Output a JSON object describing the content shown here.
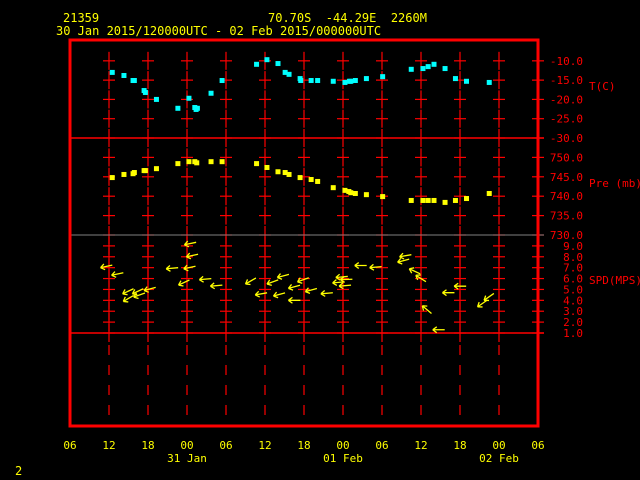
{
  "header": {
    "station": "21359",
    "location": "70.70S  -44.29E  2260M",
    "period": "30 Jan 2015/120000UTC - 02 Feb 2015/000000UTC"
  },
  "footer_label": "2",
  "colors": {
    "frame": "#ff0000",
    "text": "#ffff00",
    "temperature": "#00ffff",
    "pressure": "#ffff00",
    "wind": "#ffff00",
    "separator": "#808080"
  },
  "chart_data": {
    "type": "scatter",
    "title": "21359  70.70S -44.29E 2260M",
    "time_axis": {
      "unit": "hours since 30 Jan 2015 12Z",
      "range": [
        -6,
        66
      ],
      "tick_labels": [
        "06",
        "12",
        "18",
        "00",
        "06",
        "12",
        "18",
        "00",
        "06",
        "12",
        "18",
        "00",
        "06"
      ],
      "date_labels": [
        {
          "label": "31 Jan",
          "hour": 12
        },
        {
          "label": "01 Feb",
          "hour": 36
        },
        {
          "label": "02 Feb",
          "hour": 60
        }
      ]
    },
    "panels": [
      {
        "name": "temperature",
        "label": "T(C)",
        "ylim": [
          -30,
          -4.6
        ],
        "ticks": [
          "-10.0",
          "-15.0",
          "-20.0",
          "-25.0",
          "-30.0"
        ],
        "tick_values": [
          -10,
          -15,
          -20,
          -25,
          -30
        ],
        "points": [
          [
            0.5,
            -13.0
          ],
          [
            2.3,
            -13.8
          ],
          [
            3.7,
            -15.1
          ],
          [
            3.9,
            -15.1
          ],
          [
            5.4,
            -17.7
          ],
          [
            5.6,
            -18.2
          ],
          [
            7.3,
            -20.0
          ],
          [
            10.6,
            -22.3
          ],
          [
            12.3,
            -19.7
          ],
          [
            13.2,
            -22.1
          ],
          [
            13.4,
            -22.6
          ],
          [
            13.6,
            -22.3
          ],
          [
            15.7,
            -18.4
          ],
          [
            17.4,
            -15.1
          ],
          [
            22.7,
            -10.9
          ],
          [
            24.3,
            -9.7
          ],
          [
            26.0,
            -10.7
          ],
          [
            27.1,
            -13.0
          ],
          [
            27.7,
            -13.5
          ],
          [
            29.4,
            -14.6
          ],
          [
            29.5,
            -15.1
          ],
          [
            31.1,
            -15.1
          ],
          [
            32.1,
            -15.1
          ],
          [
            34.5,
            -15.3
          ],
          [
            36.3,
            -15.6
          ],
          [
            37.0,
            -15.3
          ],
          [
            37.2,
            -15.3
          ],
          [
            37.9,
            -15.1
          ],
          [
            39.6,
            -14.6
          ],
          [
            42.1,
            -14.1
          ],
          [
            46.5,
            -12.2
          ],
          [
            48.3,
            -12.0
          ],
          [
            49.1,
            -11.5
          ],
          [
            50.0,
            -10.9
          ],
          [
            51.7,
            -12.0
          ],
          [
            53.3,
            -14.6
          ],
          [
            55.0,
            -15.3
          ],
          [
            58.5,
            -15.6
          ]
        ]
      },
      {
        "name": "pressure",
        "label": "Pre (mb)",
        "ylim": [
          730,
          755
        ],
        "ticks": [
          "750.0",
          "745.0",
          "740.0",
          "735.0",
          "730.0"
        ],
        "tick_values": [
          750,
          745,
          740,
          735,
          730
        ],
        "points": [
          [
            0.5,
            744.8
          ],
          [
            2.3,
            745.6
          ],
          [
            3.7,
            745.8
          ],
          [
            3.9,
            746.1
          ],
          [
            5.4,
            746.6
          ],
          [
            5.6,
            746.6
          ],
          [
            7.3,
            747.1
          ],
          [
            10.6,
            748.4
          ],
          [
            12.3,
            748.9
          ],
          [
            13.2,
            748.9
          ],
          [
            13.5,
            748.6
          ],
          [
            15.7,
            748.9
          ],
          [
            17.4,
            748.9
          ],
          [
            22.7,
            748.4
          ],
          [
            24.3,
            747.4
          ],
          [
            26.0,
            746.3
          ],
          [
            27.1,
            746.1
          ],
          [
            27.7,
            745.6
          ],
          [
            29.4,
            744.8
          ],
          [
            31.1,
            744.3
          ],
          [
            32.1,
            743.8
          ],
          [
            34.5,
            742.2
          ],
          [
            36.3,
            741.5
          ],
          [
            36.9,
            741.2
          ],
          [
            37.2,
            740.9
          ],
          [
            37.9,
            740.7
          ],
          [
            39.6,
            740.4
          ],
          [
            42.1,
            739.9
          ],
          [
            46.5,
            738.9
          ],
          [
            48.3,
            738.9
          ],
          [
            49.1,
            738.9
          ],
          [
            50.0,
            738.9
          ],
          [
            51.7,
            738.4
          ],
          [
            53.3,
            738.9
          ],
          [
            55.0,
            739.4
          ],
          [
            58.5,
            740.7
          ]
        ]
      },
      {
        "name": "wind_speed",
        "label": "SPD(MPS)",
        "ylim": [
          1,
          10
        ],
        "ticks": [
          "9.0",
          "8.0",
          "7.0",
          "6.0",
          "5.0",
          "4.0",
          "3.0",
          "2.0",
          "1.0"
        ],
        "tick_values": [
          9,
          8,
          7,
          6,
          5,
          4,
          3,
          2,
          1
        ],
        "arrows_note": "[hour, speed, arrow direction in degrees (0=east, 90=north)]",
        "arrows": [
          [
            -1.3,
            7.0,
            192
          ],
          [
            0.4,
            6.3,
            192
          ],
          [
            2.1,
            4.6,
            205
          ],
          [
            2.2,
            3.9,
            210
          ],
          [
            3.6,
            4.6,
            205
          ],
          [
            3.8,
            4.3,
            200
          ],
          [
            5.4,
            4.9,
            195
          ],
          [
            8.8,
            6.9,
            185
          ],
          [
            11.6,
            9.1,
            192
          ],
          [
            11.9,
            8.0,
            192
          ],
          [
            11.5,
            6.9,
            192
          ],
          [
            10.7,
            5.4,
            205
          ],
          [
            13.9,
            5.9,
            185
          ],
          [
            15.6,
            5.3,
            185
          ],
          [
            21.0,
            5.5,
            210
          ],
          [
            22.5,
            4.5,
            190
          ],
          [
            24.3,
            5.5,
            200
          ],
          [
            25.3,
            4.4,
            195
          ],
          [
            25.9,
            6.1,
            195
          ],
          [
            27.6,
            4.0,
            180
          ],
          [
            27.6,
            5.1,
            195
          ],
          [
            29.0,
            5.7,
            200
          ],
          [
            30.2,
            4.8,
            195
          ],
          [
            32.6,
            4.6,
            185
          ],
          [
            34.4,
            5.6,
            185
          ],
          [
            34.9,
            6.1,
            185
          ],
          [
            35.4,
            5.3,
            185
          ],
          [
            35.6,
            5.9,
            182
          ],
          [
            37.8,
            7.2,
            180
          ],
          [
            40.1,
            7.0,
            185
          ],
          [
            44.7,
            8.0,
            190
          ],
          [
            44.4,
            7.5,
            195
          ],
          [
            46.2,
            6.9,
            155
          ],
          [
            47.2,
            6.3,
            148
          ],
          [
            48.2,
            3.5,
            140
          ],
          [
            51.3,
            4.7,
            180
          ],
          [
            53.1,
            5.3,
            180
          ],
          [
            56.7,
            3.4,
            215
          ],
          [
            57.7,
            4.0,
            215
          ],
          [
            49.8,
            1.3,
            180
          ]
        ]
      }
    ]
  }
}
